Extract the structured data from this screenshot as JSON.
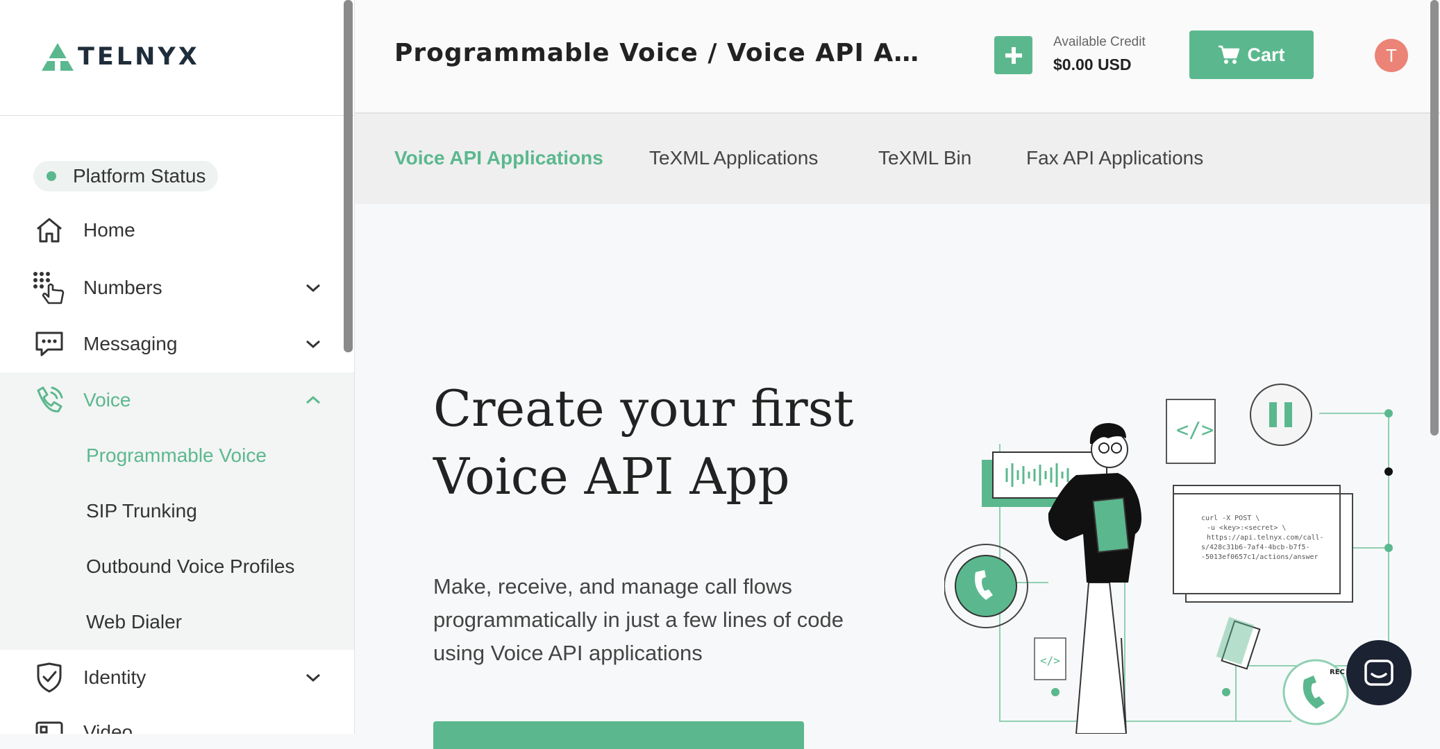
{
  "app": {
    "logo_text": "TELNYX"
  },
  "sidebar": {
    "status": {
      "label": "Platform Status",
      "color": "#5bb88e"
    },
    "items": [
      {
        "label": "Home",
        "icon": "home-icon"
      },
      {
        "label": "Numbers",
        "icon": "dialpad-hand-icon",
        "expandable": true
      },
      {
        "label": "Messaging",
        "icon": "chat-bubble-icon",
        "expandable": true
      },
      {
        "label": "Voice",
        "icon": "phone-waves-icon",
        "expanded": true,
        "active": true
      },
      {
        "label": "Identity",
        "icon": "shield-check-icon",
        "expandable": true
      },
      {
        "label": "Video",
        "icon": "video-icon"
      }
    ],
    "voice_sub_items": [
      {
        "label": "Programmable Voice",
        "active": true
      },
      {
        "label": "SIP Trunking"
      },
      {
        "label": "Outbound Voice Profiles"
      },
      {
        "label": "Web Dialer"
      }
    ]
  },
  "header": {
    "title": "Programmable Voice / Voice API Applica…",
    "credit_label": "Available Credit",
    "credit_value": "$0.00 USD",
    "cart_label": "Cart",
    "avatar_initial": "T"
  },
  "tabs": [
    {
      "label": "Voice API Applications",
      "active": true
    },
    {
      "label": "TeXML Applications"
    },
    {
      "label": "TeXML Bin"
    },
    {
      "label": "Fax API Applications"
    }
  ],
  "hero": {
    "title_line1": "Create your first",
    "title_line2": "Voice API App",
    "desc_line1": "Make, receive, and manage call flows",
    "desc_line2": "programmatically in just a few lines of code",
    "desc_line3": "using Voice API applications"
  },
  "illustration": {
    "code_line1": "curl -X POST \\",
    "code_line2": "-u <key>:<secret> \\",
    "code_line3": "https://api.telnyx.com/call-",
    "code_line4": "s/428c31b6-7af4-4bcb-b7f5-",
    "code_line5": "-5013ef0657c1/actions/answer",
    "rec_label": "REC"
  },
  "colors": {
    "accent": "#5bb88e",
    "avatar": "#ec8377",
    "chat": "#1b2232"
  }
}
